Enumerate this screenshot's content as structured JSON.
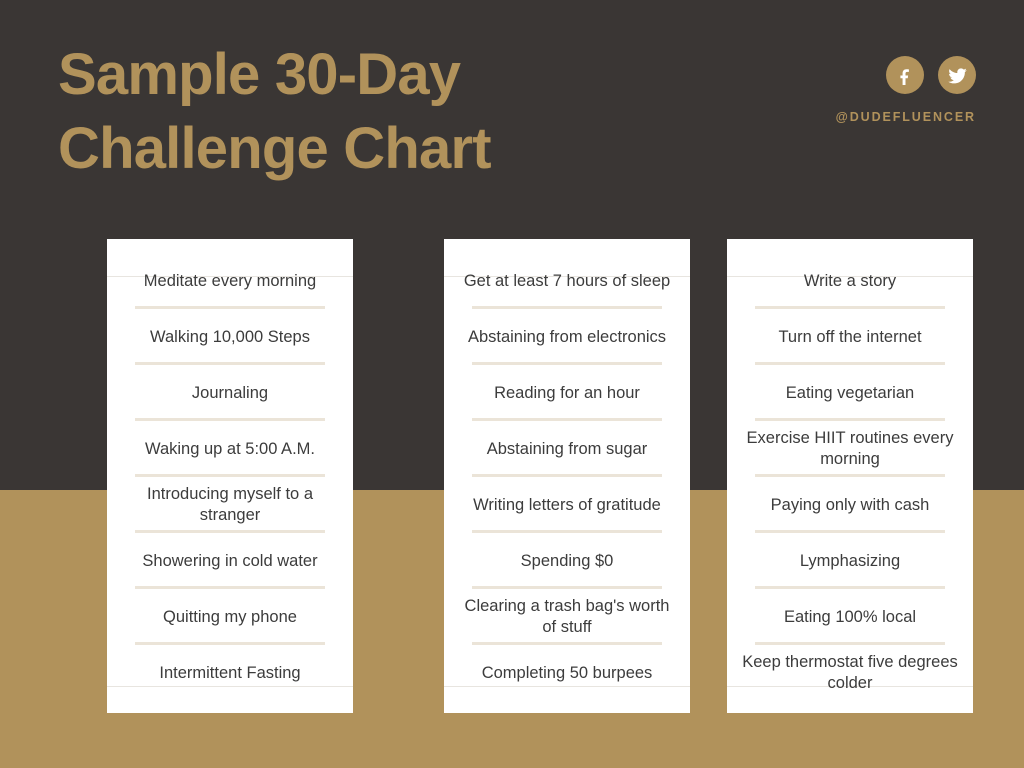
{
  "header": {
    "title": "Sample 30-Day\nChallenge Chart",
    "social": {
      "handle": "@DUDEFLUENCER",
      "icons": [
        {
          "name": "facebook-icon",
          "label": "Facebook"
        },
        {
          "name": "twitter-icon",
          "label": "Twitter"
        }
      ]
    }
  },
  "colors": {
    "background_dark": "#3A3634",
    "background_gold": "#B1925B",
    "accent_gold": "#B1925B",
    "card_background": "#FFFFFF",
    "separator": "#EBE4D8",
    "item_text": "#3C3C3C"
  },
  "columns": [
    {
      "items": [
        "Meditate every morning",
        "Walking 10,000 Steps",
        "Journaling",
        "Waking up at 5:00 A.M.",
        "Introducing myself to a stranger",
        "Showering in cold water",
        "Quitting my phone",
        "Intermittent Fasting"
      ]
    },
    {
      "items": [
        "Get at least 7 hours of sleep",
        "Abstaining from electronics",
        "Reading for an hour",
        "Abstaining from sugar",
        "Writing letters of gratitude",
        "Spending $0",
        "Clearing a trash bag's worth of stuff",
        "Completing 50 burpees"
      ]
    },
    {
      "items": [
        "Write a story",
        "Turn off the internet",
        "Eating vegetarian",
        "Exercise HIIT routines every morning",
        "Paying only with cash",
        "Lymphasizing",
        "Eating 100% local",
        "Keep thermostat five degrees colder"
      ]
    }
  ]
}
